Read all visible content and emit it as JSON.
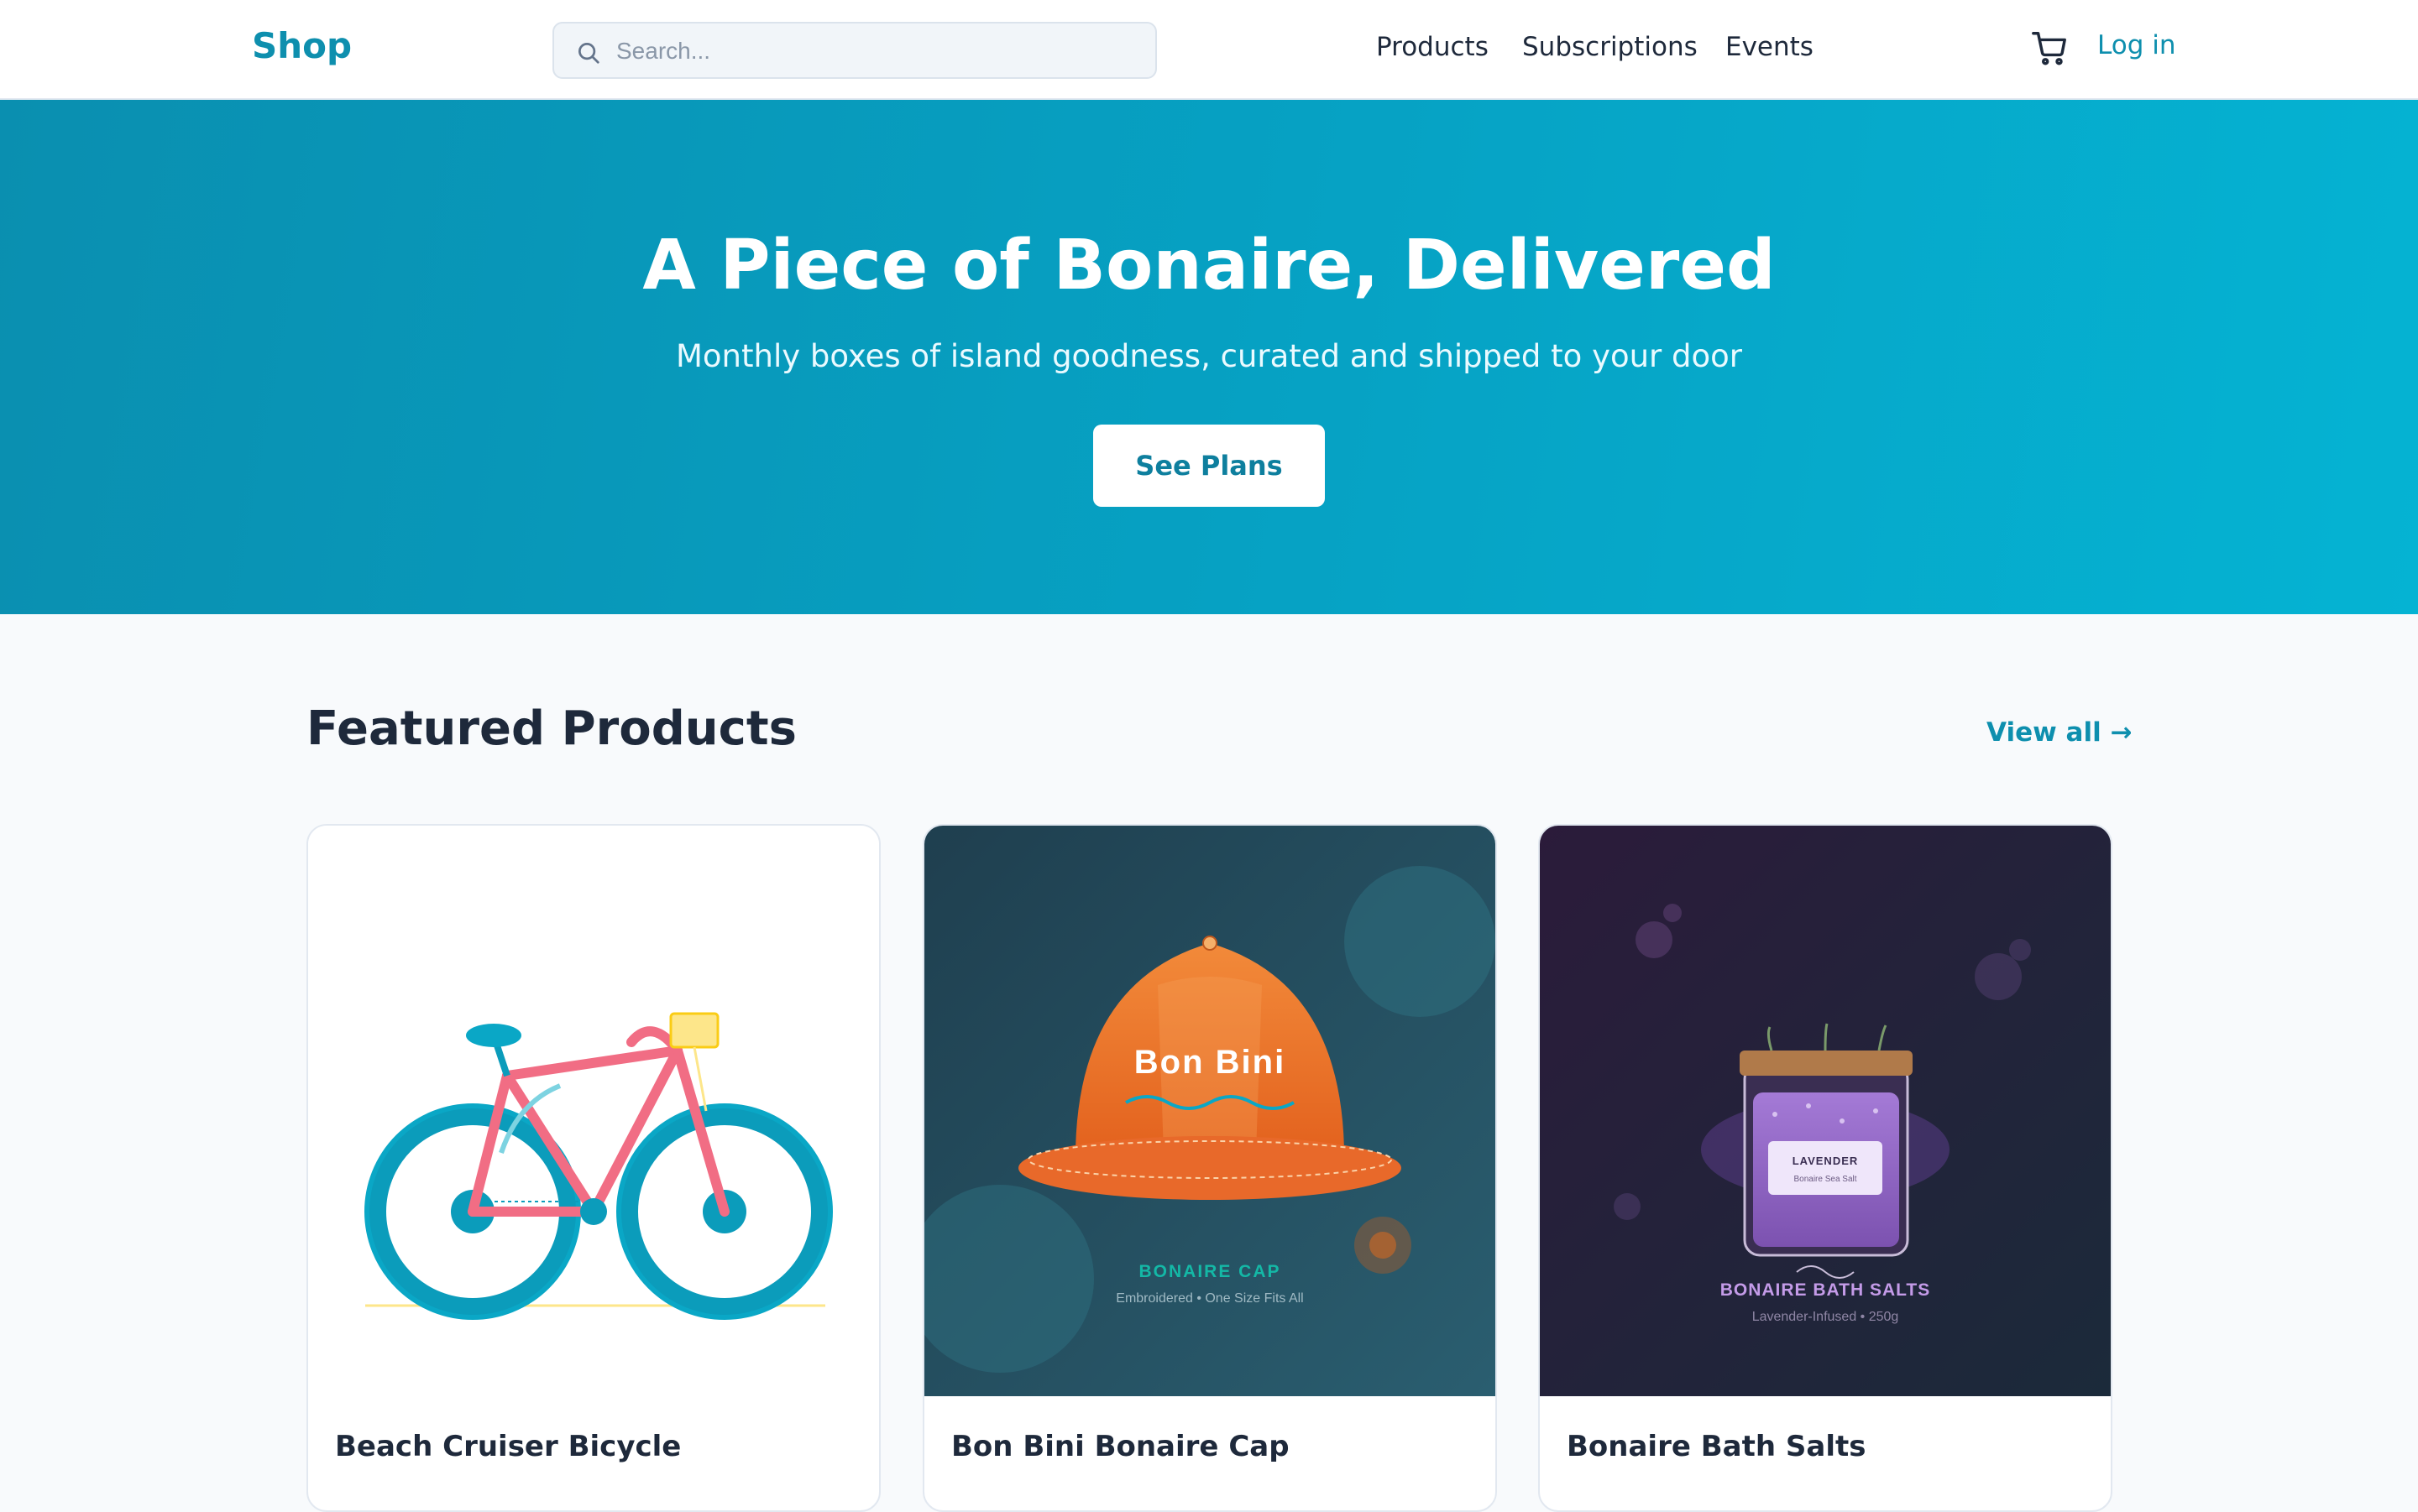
{
  "header": {
    "logo": "Shop",
    "search_placeholder": "Search...",
    "nav": [
      "Products",
      "Subscriptions",
      "Events"
    ],
    "login": "Log in"
  },
  "hero": {
    "title": "A Piece of Bonaire, Delivered",
    "subtitle": "Monthly boxes of island goodness, curated and shipped to your door",
    "cta": "See Plans"
  },
  "featured": {
    "title": "Featured Products",
    "view_all": "View all →",
    "products": [
      {
        "name": "Beach Cruiser Bicycle"
      },
      {
        "name": "Bon Bini Bonaire Cap",
        "image_text": {
          "cap_text": "Bon Bini",
          "label": "BONAIRE CAP",
          "detail": "Embroidered • One Size Fits All"
        }
      },
      {
        "name": "Bonaire Bath Salts",
        "image_text": {
          "jar_label": "LAVENDER",
          "jar_sublabel": "Bonaire Sea Salt",
          "label": "BONAIRE BATH SALTS",
          "detail": "Lavender-Infused • 250g"
        }
      }
    ]
  },
  "colors": {
    "brand": "#0e8fae",
    "hero_start": "#0a8fb0",
    "hero_end": "#05b3d3"
  }
}
